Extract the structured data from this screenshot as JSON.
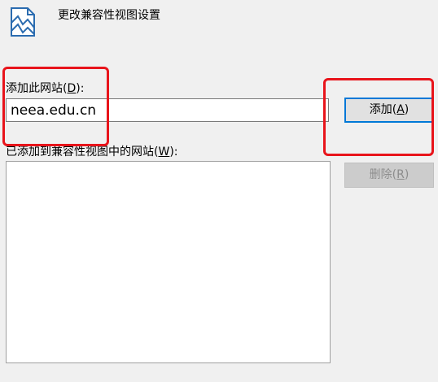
{
  "dialog": {
    "title": "更改兼容性视图设置",
    "icon": "compat-view-settings-icon"
  },
  "add_site": {
    "label_prefix": "添加此网站(",
    "label_key": "D",
    "label_suffix": "):",
    "value": "neea.edu.cn"
  },
  "buttons": {
    "add_prefix": "添加(",
    "add_key": "A",
    "add_suffix": ")",
    "remove_prefix": "删除(",
    "remove_key": "R",
    "remove_suffix": ")"
  },
  "site_list": {
    "label_prefix": "已添加到兼容性视图中的网站(",
    "label_key": "W",
    "label_suffix": "):",
    "items": []
  },
  "annotations": {
    "highlight_color": "#e8141b"
  }
}
